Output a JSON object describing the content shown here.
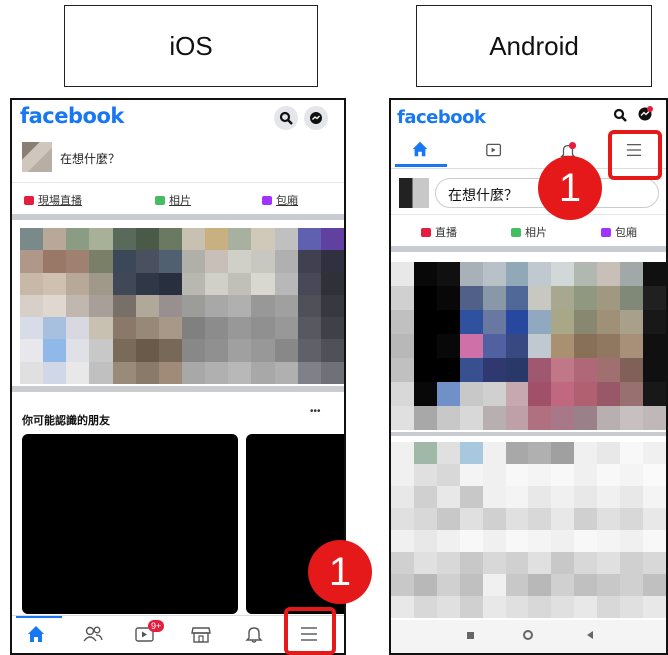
{
  "ios": {
    "platform_label": "iOS",
    "logo": "facebook",
    "compose_placeholder": "在想什麼？",
    "actions": [
      {
        "label": "現場直播",
        "color": "#e41e3f"
      },
      {
        "label": "相片",
        "color": "#45bd62"
      },
      {
        "label": "包廂",
        "color": "#a033ff"
      }
    ],
    "people_section_title": "你可能認識的朋友",
    "more_icon": "•••",
    "tab_video_badge": "9+",
    "step_number": "1",
    "tabs": [
      "home-icon",
      "friends-icon",
      "video-icon",
      "marketplace-icon",
      "bell-icon",
      "menu-icon"
    ]
  },
  "android": {
    "platform_label": "Android",
    "logo": "facebook",
    "compose_placeholder": "在想什麼？",
    "actions": [
      {
        "label": "直播",
        "color": "#e41e3f"
      },
      {
        "label": "相片",
        "color": "#45bd62"
      },
      {
        "label": "包廂",
        "color": "#a033ff"
      }
    ],
    "step_number": "1",
    "tabs": [
      "home-icon",
      "video-icon",
      "notifications-icon",
      "menu-icon"
    ]
  },
  "colors": {
    "brand": "#1877f2",
    "highlight": "#e51919"
  }
}
